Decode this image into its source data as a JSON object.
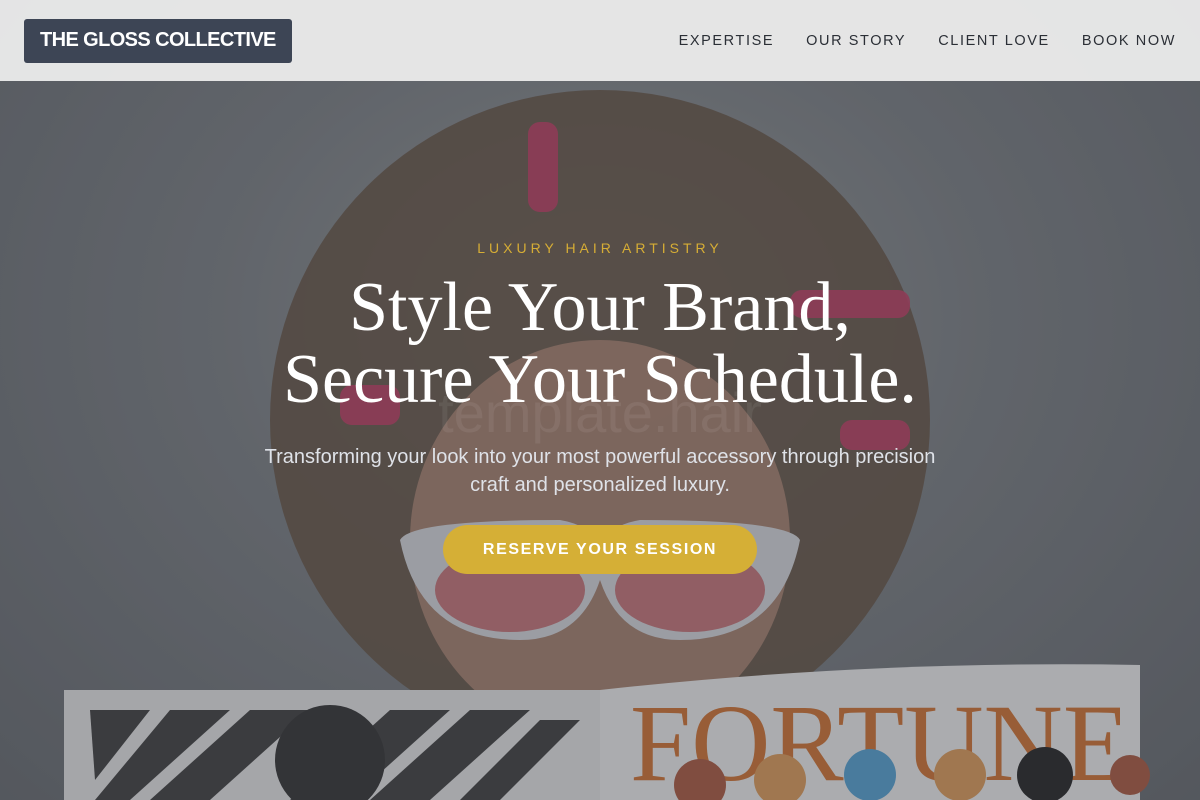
{
  "brand": {
    "name": "THE GLOSS COLLECTIVE"
  },
  "nav": {
    "items": [
      {
        "label": "EXPERTISE"
      },
      {
        "label": "OUR STORY"
      },
      {
        "label": "CLIENT LOVE"
      },
      {
        "label": "BOOK NOW"
      }
    ]
  },
  "hero": {
    "eyebrow": "LUXURY HAIR ARTISTRY",
    "headline_line1": "Style Your Brand,",
    "headline_line2": "Secure Your Schedule.",
    "subhead": "Transforming your look into your most powerful accessory through precision craft and personalized luxury.",
    "cta_label": "RESERVE YOUR SESSION",
    "watermark": "template.hair",
    "magazine_title": "FORTUNE"
  },
  "colors": {
    "header_bg": "#ececec",
    "logo_bg": "#3d4555",
    "accent_gold": "#d5af36",
    "eyebrow_gold": "#d6ad35"
  },
  "icons": {
    "hero_image": "hero-photo-woman-with-magazine"
  }
}
